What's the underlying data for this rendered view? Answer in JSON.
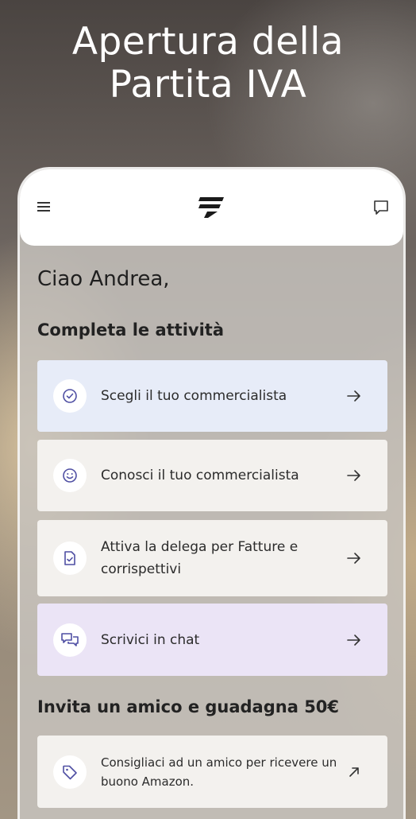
{
  "headline": {
    "line1": "Apertura della",
    "line2": "Partita IVA"
  },
  "greeting": "Ciao Andrea,",
  "tasks": {
    "title": "Completa le attività",
    "items": [
      {
        "label": "Scegli il tuo commercialista",
        "icon": "check-circle-icon",
        "bg": "#e7ecf8"
      },
      {
        "label": "Conosci il tuo commercialista",
        "icon": "smiley-icon",
        "bg": "#f3f1ee"
      },
      {
        "label": "Attiva la delega per Fatture e corrispettivi",
        "icon": "document-check-icon",
        "bg": "#f3f1ee"
      },
      {
        "label": "Scrivici in chat",
        "icon": "chat-bubbles-icon",
        "bg": "#ebe4f6"
      }
    ]
  },
  "referral": {
    "title": "Invita un amico e guadagna 50€",
    "card_label": "Consigliaci ad un amico per ricevere un buono Amazon.",
    "icon": "tag-icon"
  },
  "colors": {
    "icon_accent": "#4f4fa3"
  }
}
